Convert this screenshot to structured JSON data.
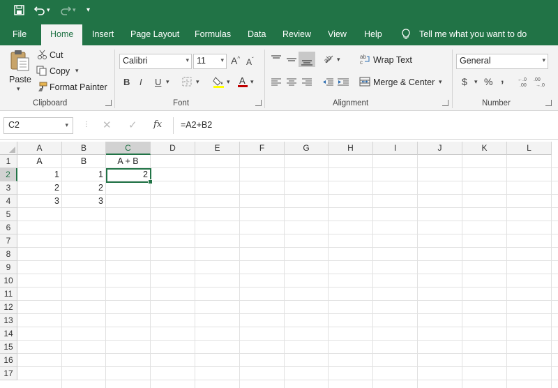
{
  "quick_access": {
    "save_icon": "save-icon",
    "undo_icon": "undo-icon",
    "redo_icon": "redo-icon",
    "customize_glyph": "▾"
  },
  "tabs": [
    "File",
    "Home",
    "Insert",
    "Page Layout",
    "Formulas",
    "Data",
    "Review",
    "View",
    "Help"
  ],
  "active_tab": "Home",
  "tell_me": "Tell me what you want to do",
  "clipboard": {
    "paste": "Paste",
    "cut": "Cut",
    "copy": "Copy",
    "format_painter": "Format Painter",
    "group": "Clipboard"
  },
  "font": {
    "name": "Calibri",
    "size": "11",
    "bold": "B",
    "italic": "I",
    "underline": "U",
    "group": "Font"
  },
  "alignment": {
    "wrap_text": "Wrap Text",
    "merge_center": "Merge & Center",
    "group": "Alignment"
  },
  "number": {
    "format": "General",
    "currency": "$",
    "percent": "%",
    "comma": ",",
    "group": "Number"
  },
  "formula_bar": {
    "name_box": "C2",
    "fx": "fx",
    "formula": "=A2+B2"
  },
  "colors": {
    "brand": "#217346",
    "ribbon_bg": "#f3f3f3",
    "font_color_bar": "#c00000",
    "highlight_bar": "#ffff00"
  },
  "sheet": {
    "columns": [
      "A",
      "B",
      "C",
      "D",
      "E",
      "F",
      "G",
      "H",
      "I",
      "J",
      "K",
      "L"
    ],
    "rows": [
      "1",
      "2",
      "3",
      "4",
      "5",
      "6",
      "7",
      "8",
      "9",
      "10",
      "11",
      "12",
      "13",
      "14",
      "15",
      "16",
      "17"
    ],
    "selected_col": "C",
    "selected_row": "2",
    "cells": {
      "A1": "A",
      "B1": "B",
      "C1": "A + B",
      "A2": "1",
      "B2": "1",
      "C2": "2",
      "A3": "2",
      "B3": "2",
      "A4": "3",
      "B4": "3"
    }
  }
}
